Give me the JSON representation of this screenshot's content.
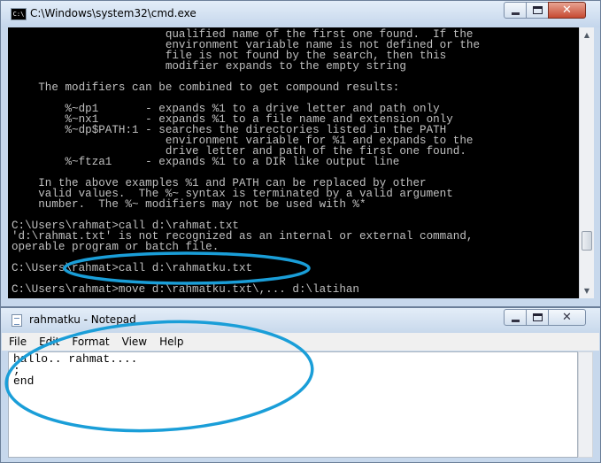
{
  "cmd": {
    "title": "C:\\Windows\\system32\\cmd.exe",
    "icon": "cmd-icon",
    "icon_text": "C:\\",
    "console_lines": [
      "                       qualified name of the first one found.  If the",
      "                       environment variable name is not defined or the",
      "                       file is not found by the search, then this",
      "                       modifier expands to the empty string",
      "",
      "    The modifiers can be combined to get compound results:",
      "",
      "        %~dp1       - expands %1 to a drive letter and path only",
      "        %~nx1       - expands %1 to a file name and extension only",
      "        %~dp$PATH:1 - searches the directories listed in the PATH",
      "                       environment variable for %1 and expands to the",
      "                       drive letter and path of the first one found.",
      "        %~ftza1     - expands %1 to a DIR like output line",
      "",
      "    In the above examples %1 and PATH can be replaced by other",
      "    valid values.  The %~ syntax is terminated by a valid argument",
      "    number.  The %~ modifiers may not be used with %*",
      "",
      "C:\\Users\\rahmat>call d:\\rahmat.txt",
      "'d:\\rahmat.txt' is not recognized as an internal or external command,",
      "operable program or batch file.",
      "",
      "C:\\Users\\rahmat>call d:\\rahmatku.txt",
      "",
      "C:\\Users\\rahmat>move d:\\rahmatku.txt\\,... d:\\latihan"
    ],
    "colors": {
      "console_bg": "#000000",
      "console_fg": "#c0c0c0"
    }
  },
  "notepad": {
    "title": "rahmatku - Notepad",
    "menu": [
      "File",
      "Edit",
      "Format",
      "View",
      "Help"
    ],
    "content_lines": [
      "hallo.. rahmat....",
      ";",
      "end"
    ]
  },
  "window_buttons": {
    "minimize": "minimize-icon",
    "maximize": "maximize-icon",
    "close_label": "✕"
  },
  "annotations": {
    "color": "#1a9ed8"
  }
}
